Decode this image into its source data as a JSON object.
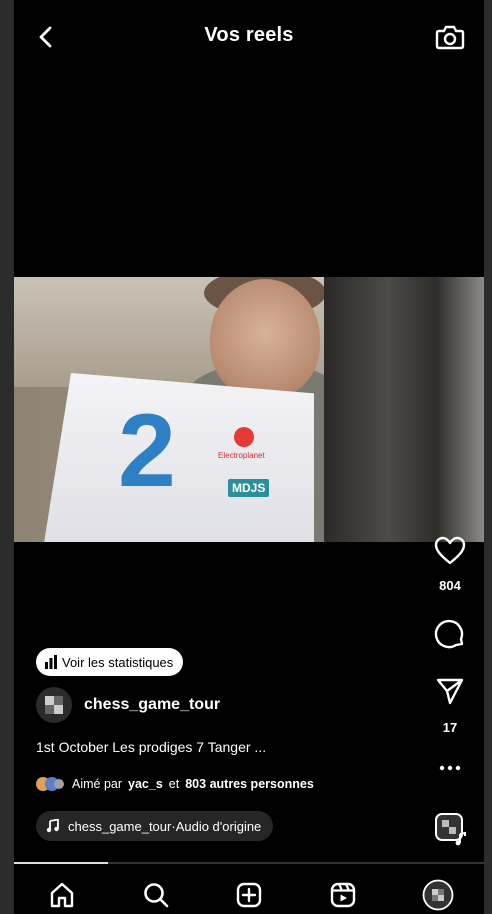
{
  "header": {
    "title": "Vos reels",
    "back_icon": "chevron-left-icon",
    "camera_icon": "camera-icon"
  },
  "actions": {
    "likes": "804",
    "shares": "17"
  },
  "video": {
    "tent_number": "2",
    "logo_text": "Electroplanet",
    "badge_text": "MDJS"
  },
  "stats_button": {
    "label": "Voir les statistiques"
  },
  "post": {
    "username": "chess_game_tour",
    "caption": "1st October Les prodiges 7 Tanger ...",
    "liked_prefix": "Aimé par",
    "liked_user": "yac_s",
    "liked_connector": "et",
    "liked_rest": "803 autres personnes"
  },
  "audio": {
    "user": "chess_game_tour",
    "separator": " · ",
    "label": "Audio d'origine"
  },
  "progress": {
    "fraction": 0.2
  },
  "nav": {
    "items": [
      "home-icon",
      "search-icon",
      "create-icon",
      "reels-icon",
      "profile-avatar"
    ]
  }
}
